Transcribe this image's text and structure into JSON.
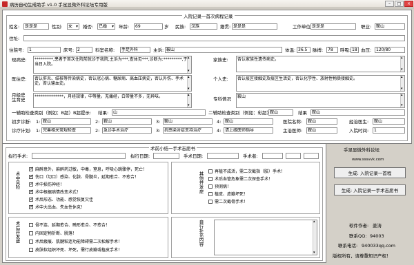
{
  "window": {
    "title": "病历自动生成助手 v1.0 手足显微外科论坛专用版",
    "min": "–",
    "max": "□",
    "close": "×"
  },
  "record": {
    "legend": "入院记录一首次病程记录",
    "name_label": "姓名:",
    "name": "是是是",
    "sex_label": "性别:",
    "sex": "女",
    "marital_label": "婚否:",
    "marital": "已婚",
    "age_label": "年龄:",
    "age": "69",
    "age_unit": "岁",
    "nation_label": "民族:",
    "nation": "汉族",
    "origin_label": "籍贯:",
    "origin": "是是是",
    "work_label": "工作单位",
    "work": "是是是",
    "job_label": "职业:",
    "job": "鞍山",
    "address_label": "住址:",
    "address": "",
    "bed_label": "住院号:",
    "bed": "1",
    "bedno_label": "床号:",
    "bedno": "2",
    "dept_label": "科室名称:",
    "dept": "手足外科",
    "ward_label": "主诉:",
    "ward": "鞍山",
    "temp_label": "体温:",
    "temp": "36.5",
    "pulse_label": "脉搏:",
    "pulse": "78",
    "resp_label": "呼吸:",
    "resp": "18",
    "bp_label": "血压:",
    "bp": "120/80",
    "hpi_label": "现病史:",
    "hpi": "*********,患者于首次住院前就诊于我院,主诉为***,查体见***,诊断为:*********,于当日入院。",
    "past_label": "既往史:",
    "past": "否认肝炎、结核等传染病史，否认冠心病、糖尿病、高血压病史，否认外伤、手术史，否认输血史。",
    "menses_label": "月经史\n生育史",
    "menses": "**************，月经规律，中等量，无痛经，白带量不多，无异味。",
    "family_label": "家族史:",
    "family": "否认家族性遗传病史。",
    "personal_label": "个人史:",
    "personal": "否认疫区接触史及疫区生活史，否认化学性、放射性物质接触史。",
    "special_label": "专科情况",
    "special": "鞍山",
    "exam1_label": "一辅助检查类别（例如：B超）B超提示:",
    "exam1_result_label": "结果:",
    "exam1": "山",
    "exam2_label": "二辅助检查类别（例如：彩超）",
    "exam2": "鞍山",
    "exam2_result_label": "结果",
    "exam2_result": "鞍山",
    "diag_label": "初步诊断:",
    "diag1_n": "1:",
    "diag1": "鞍山",
    "diag2_n": "2:",
    "diag2": "鞍山",
    "diag3_n": "3:",
    "diag3": "鞍山",
    "diag4_n": "4:",
    "diag4": "鞍山",
    "doctor_label": "医院名称:",
    "doctor": "鞍山",
    "resident_label": "经治医生:",
    "resident": "鞍山",
    "plan_label": "诊疗计划:",
    "plan1_n": "1:",
    "plan1": "完善相关常规检查",
    "plan2_n": "2:",
    "plan2": "急诊手术治疗",
    "plan3_n": "3:",
    "plan3": "抗感染对症支持治疗",
    "plan4_n": "4:",
    "plan4": "请上级医师指导",
    "chief_label": "主治医师:",
    "chief": "鞍山",
    "time_label": "入院时间:",
    "time": "1"
  },
  "surgery": {
    "legend": "术前小结一手术志愿书",
    "opname_label": "拟行手术:",
    "opname": "",
    "opdate_label": "拟行日期:",
    "opdate": "",
    "optime_label": "手术日期:",
    "optime": "",
    "surgeon_label": "手术者:",
    "surgeon": "",
    "risk_label": "术中风险",
    "after_label": "术后并发症",
    "other_label": "其他并发症",
    "notes_label": "自行补充内容",
    "risks": [
      {
        "text": "麻醉意外，麻醉药过敏，中毒，窒息，呼吸心跳骤停，死亡！",
        "checked": true
      },
      {
        "text": "伤口（切口）感染、化脓、骨髓炎，延期愈合、不愈合！",
        "checked": true
      },
      {
        "text": "术中损伤神经！",
        "checked": true
      },
      {
        "text": "术中根据病情改变术式！",
        "checked": true
      },
      {
        "text": "术后形态、功能、感觉恢复欠佳",
        "checked": true
      },
      {
        "text": "术中大出血、失血性休克！",
        "checked": true
      }
    ],
    "after": [
      {
        "text": "骨不连、延期愈合、畸形愈合、不愈合！",
        "checked": false
      },
      {
        "text": "内固定物折断、脱落！",
        "checked": false
      },
      {
        "text": "术后瘢痕、肌腱粘连功能障碍需二次松解手术！",
        "checked": false
      },
      {
        "text": "皮肤软组织坏死、坏死，需行皮瓣或植皮手术！",
        "checked": false
      }
    ],
    "right": [
      {
        "text": "再植不成活，需二次截指（肢）手术！",
        "checked": false
      },
      {
        "text": "术后血管危象需二次探查手术！",
        "checked": false
      },
      {
        "text": "预测病！",
        "checked": false
      },
      {
        "text": "植皮、皮瓣坏死！",
        "checked": false
      },
      {
        "text": "需二次截骨手术！",
        "checked": false
      }
    ]
  },
  "side": {
    "forum": "手足显微外科论坛",
    "url": "www.sssvvk.com",
    "btn1": "生成: 入院记录一首程",
    "btn2": "生成: 入院记录一手术志愿书",
    "author_label": "软件作者:",
    "author": "姜涛",
    "contact_label": "联系QQ:",
    "contact": "94003",
    "phone_label": "联系电话:",
    "phone": "940033qq.com",
    "copyright": "版权所有，请尊重知识产权！"
  }
}
